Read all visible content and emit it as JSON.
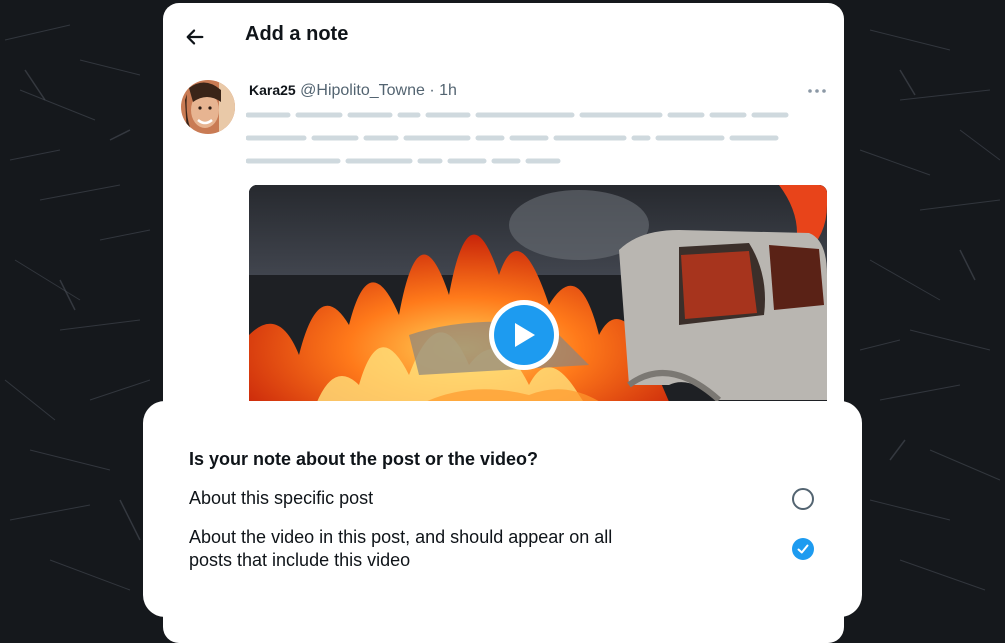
{
  "header": {
    "title": "Add a note"
  },
  "post": {
    "display_name": "Kara25",
    "handle": "@Hipolito_Towne",
    "separator": "·",
    "time": "1h"
  },
  "sheet": {
    "question": "Is your note about the post or the video?",
    "options": [
      {
        "label": "About this specific post",
        "selected": false
      },
      {
        "label": "About the video in this post, and should appear on all posts that include this video",
        "selected": true
      }
    ]
  },
  "colors": {
    "accent": "#1d9bf0",
    "text_primary": "#0f1419",
    "text_secondary": "#536471",
    "placeholder_line": "#cfd9de",
    "background": "#15181c"
  },
  "icons": {
    "back": "arrow-left-icon",
    "more": "more-dots-icon",
    "play": "play-icon",
    "check": "check-icon"
  }
}
